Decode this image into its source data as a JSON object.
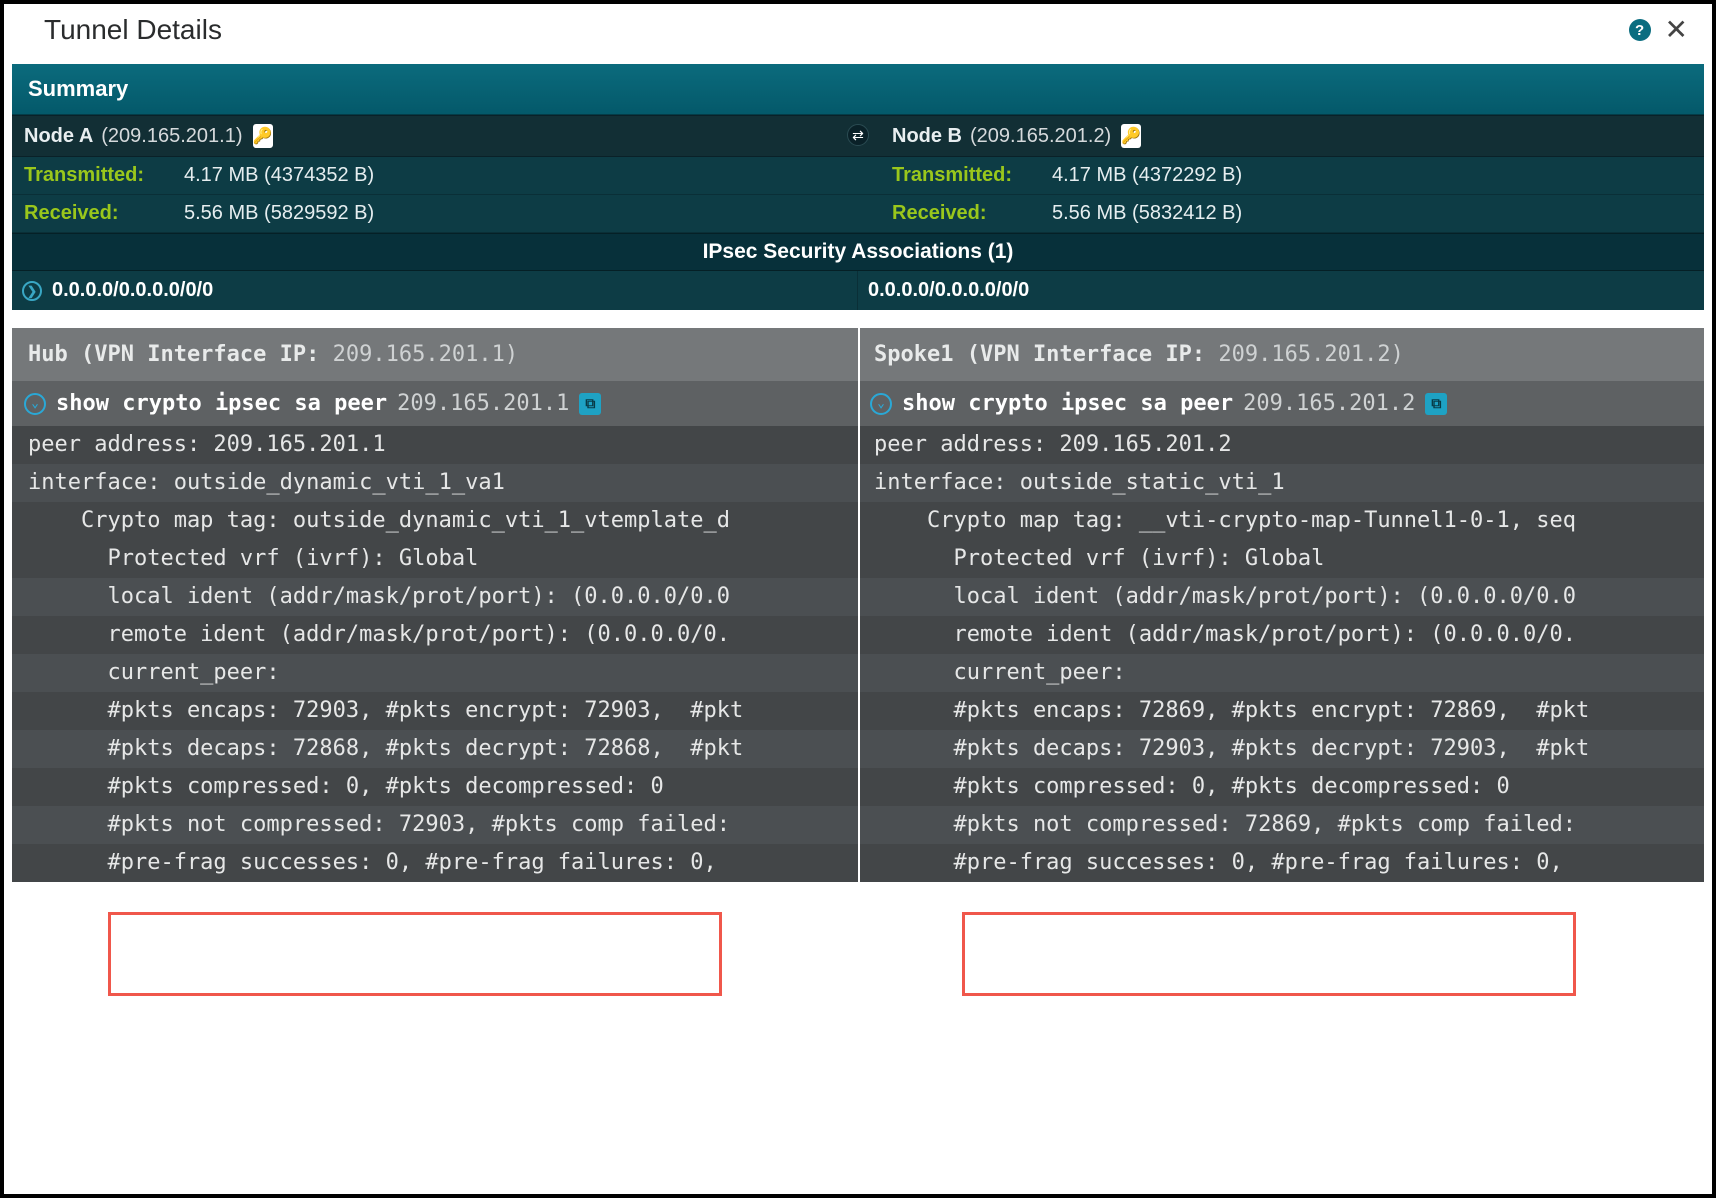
{
  "dialog": {
    "title": "Tunnel Details"
  },
  "summary": {
    "header": "Summary"
  },
  "nodeA": {
    "label": "Node A",
    "ip": "(209.165.201.1)",
    "tx_label": "Transmitted:",
    "tx_value": "4.17 MB (4374352 B)",
    "rx_label": "Received:",
    "rx_value": "5.56 MB (5829592 B)"
  },
  "nodeB": {
    "label": "Node B",
    "ip": "(209.165.201.2)",
    "tx_label": "Transmitted:",
    "tx_value": "4.17 MB (4372292 B)",
    "rx_label": "Received:",
    "rx_value": "5.56 MB (5832412 B)"
  },
  "ipsec": {
    "header": "IPsec Security Associations (1)",
    "sa_left": "0.0.0.0/0.0.0.0/0/0",
    "sa_right": "0.0.0.0/0.0.0.0/0/0"
  },
  "hub": {
    "title_prefix": "Hub (VPN Interface IP:",
    "title_ip": "209.165.201.1)",
    "cmd": "show crypto ipsec sa peer",
    "cmd_ip": "209.165.201.1",
    "lines": [
      "peer address: 209.165.201.1",
      "interface: outside_dynamic_vti_1_va1",
      "    Crypto map tag: outside_dynamic_vti_1_vtemplate_d",
      "",
      "      Protected vrf (ivrf): Global",
      "      local ident (addr/mask/prot/port): (0.0.0.0/0.0",
      "      remote ident (addr/mask/prot/port): (0.0.0.0/0.",
      "      current_peer: ",
      "",
      "",
      "      #pkts encaps: 72903, #pkts encrypt: 72903,  #pkt",
      "      #pkts decaps: 72868, #pkts decrypt: 72868,  #pkt",
      "      #pkts compressed: 0, #pkts decompressed: 0",
      "      #pkts not compressed: 72903, #pkts comp failed:",
      "      #pre-frag successes: 0, #pre-frag failures: 0, "
    ]
  },
  "spoke": {
    "title_prefix": "Spoke1 (VPN Interface IP:",
    "title_ip": "209.165.201.2)",
    "cmd": "show crypto ipsec sa peer",
    "cmd_ip": "209.165.201.2",
    "lines": [
      "peer address: 209.165.201.2",
      "interface: outside_static_vti_1",
      "    Crypto map tag: __vti-crypto-map-Tunnel1-0-1, seq",
      "",
      "      Protected vrf (ivrf): Global",
      "      local ident (addr/mask/prot/port): (0.0.0.0/0.0",
      "      remote ident (addr/mask/prot/port): (0.0.0.0/0.",
      "      current_peer:",
      "",
      "",
      "      #pkts encaps: 72869, #pkts encrypt: 72869,  #pkt",
      "      #pkts decaps: 72903, #pkts decrypt: 72903,  #pkt",
      "      #pkts compressed: 0, #pkts decompressed: 0",
      "      #pkts not compressed: 72869, #pkts comp failed:",
      "      #pre-frag successes: 0, #pre-frag failures: 0, "
    ]
  }
}
